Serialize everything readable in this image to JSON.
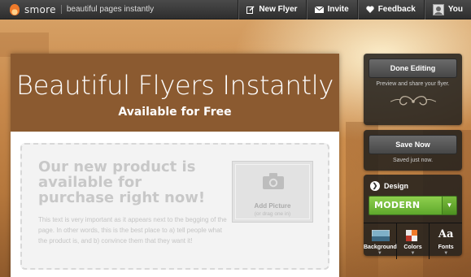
{
  "topbar": {
    "logo": "smore",
    "tagline": "beautiful pages instantly",
    "nav": [
      {
        "label": "New Flyer",
        "icon": "edit-icon"
      },
      {
        "label": "Invite",
        "icon": "envelope-icon"
      },
      {
        "label": "Feedback",
        "icon": "heart-icon"
      },
      {
        "label": "You",
        "icon": "avatar"
      }
    ]
  },
  "flyer": {
    "title": "Beautiful Flyers Instantly",
    "subtitle": "Available for Free",
    "headline": "Our new product is available for purchase right now!",
    "body": "This text is very important as it appears next to the begging of the page. In other words, this is the best place to a) tell people what the product is, and b) convince them that they want it!",
    "add_picture": {
      "label": "Add Picture",
      "sub": "(or drag one in)"
    },
    "header_color": "#8b5a30"
  },
  "sidebar": {
    "done_editing": {
      "label": "Done Editing",
      "note": "Preview and share your flyer."
    },
    "save": {
      "label": "Save Now",
      "note": "Saved just now."
    },
    "design": {
      "heading": "Design",
      "theme": "MODERN",
      "theme_color": "#7cbd3e",
      "tabs": [
        {
          "label": "Background",
          "icon": "background-swatch-icon"
        },
        {
          "label": "Colors",
          "icon": "color-swatch-icon"
        },
        {
          "label": "Fonts",
          "icon": "font-aa-icon"
        }
      ]
    }
  }
}
